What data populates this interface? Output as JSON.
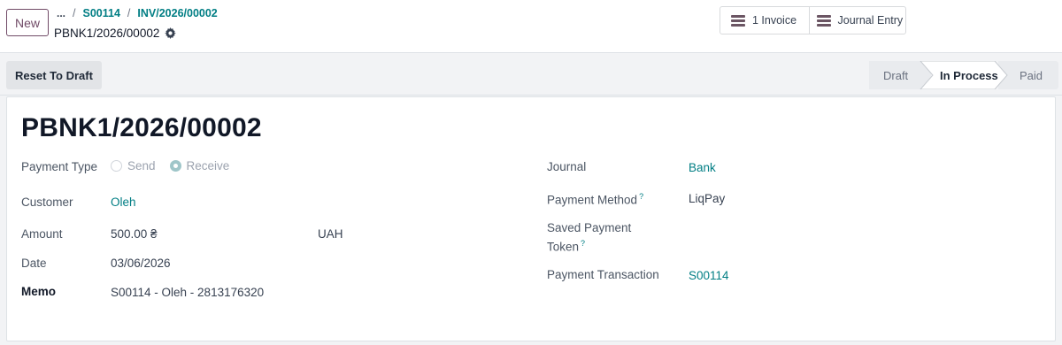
{
  "control_panel": {
    "new_button": "New",
    "breadcrumb": {
      "more": "...",
      "items": [
        "S00114",
        "INV/2026/00002"
      ],
      "separator": "/",
      "current": "PBNK1/2026/00002"
    },
    "smart_buttons": [
      {
        "label": "1 Invoice",
        "icon": "list-icon"
      },
      {
        "label": "Journal Entry",
        "icon": "list-icon"
      }
    ]
  },
  "statusbar": {
    "reset_button": "Reset To Draft",
    "stages": [
      {
        "label": "Draft",
        "active": false
      },
      {
        "label": "In Process",
        "active": true
      },
      {
        "label": "Paid",
        "active": false
      }
    ]
  },
  "form": {
    "title": "PBNK1/2026/00002",
    "left": {
      "payment_type": {
        "label": "Payment Type",
        "options": [
          "Send",
          "Receive"
        ],
        "selected": "Receive"
      },
      "customer": {
        "label": "Customer",
        "value": "Oleh"
      },
      "amount": {
        "label": "Amount",
        "value": "500.00 ₴",
        "currency": "UAH"
      },
      "date": {
        "label": "Date",
        "value": "03/06/2026"
      },
      "memo": {
        "label": "Memo",
        "value": "S00114 - Oleh - 2813176320"
      }
    },
    "right": {
      "journal": {
        "label": "Journal",
        "value": "Bank"
      },
      "payment_method": {
        "label": "Payment Method",
        "help": "?",
        "value": "LiqPay"
      },
      "saved_token": {
        "label_line1": "Saved Payment",
        "label_line2": "Token",
        "help": "?"
      },
      "transaction": {
        "label": "Payment Transaction",
        "value": "S00114"
      }
    }
  },
  "colors": {
    "brand": "#714b67",
    "link": "#017e84",
    "stage_active_bg": "#ffffff",
    "stage_inactive_bg": "#e9ebee"
  }
}
